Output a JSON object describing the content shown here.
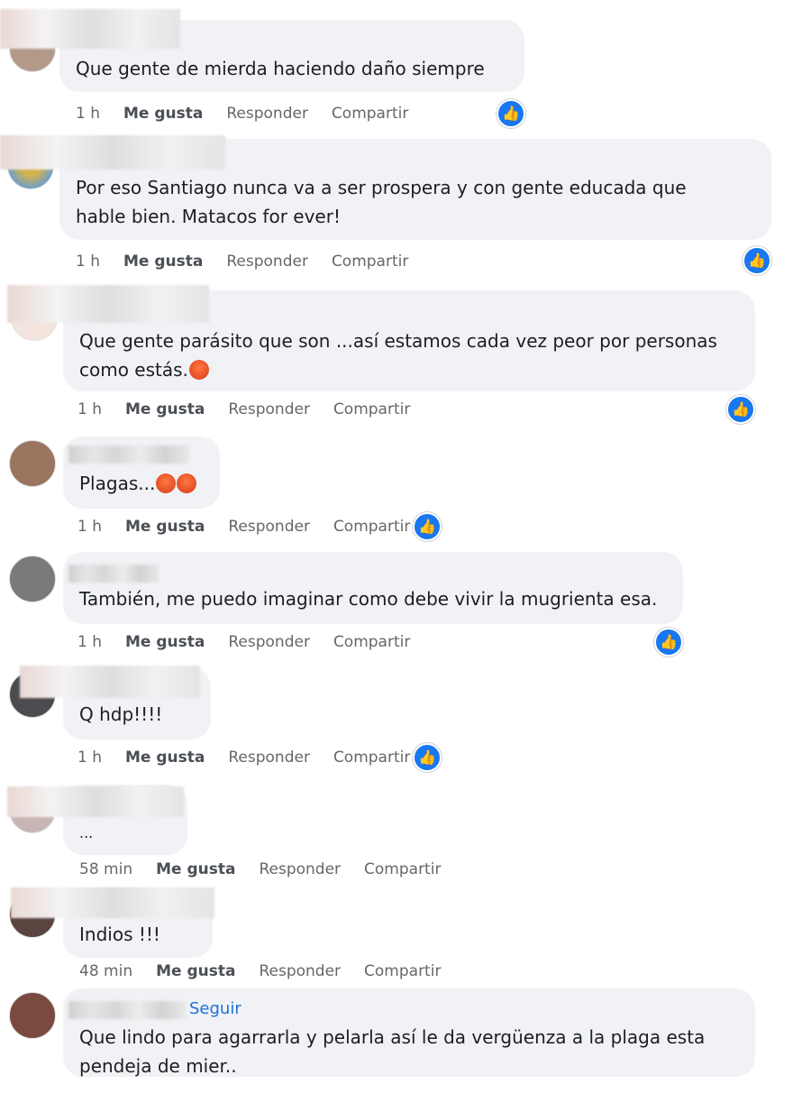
{
  "actions": {
    "like": "Me gusta",
    "reply": "Responder",
    "share": "Compartir"
  },
  "like_icon": "thumbs-up-icon",
  "accent_color": "#1877f2",
  "comments": [
    {
      "text": "Que gente de mierda haciendo daño siempre",
      "time": "1 h",
      "has_reaction": true
    },
    {
      "text": "Por eso Santiago nunca va a ser prospera y con gente educada que\nhable bien. Matacos for ever!",
      "time": "1 h",
      "has_reaction": true
    },
    {
      "text": "Que gente parásito que son ...así estamos cada vez peor por personas\ncomo estás.",
      "emoji": "angry-face-icon",
      "time": "1 h",
      "has_reaction": true
    },
    {
      "text": "Plagas...",
      "emoji": "cursing-face-icon",
      "time": "1 h",
      "has_reaction": true
    },
    {
      "text": "También, me puedo imaginar como debe vivir la mugrienta esa.",
      "time": "1 h",
      "has_reaction": true
    },
    {
      "text": "Q hdp!!!!",
      "time": "1 h",
      "has_reaction": true
    },
    {
      "text": "...",
      "time": "58 min",
      "has_reaction": false
    },
    {
      "text": "Indios !!!",
      "time": "48 min",
      "has_reaction": false
    },
    {
      "text": "Que lindo para agarrarla y pelarla así le da vergüenza a la plaga esta\npendeja de mier..",
      "follow": "Seguir"
    }
  ]
}
